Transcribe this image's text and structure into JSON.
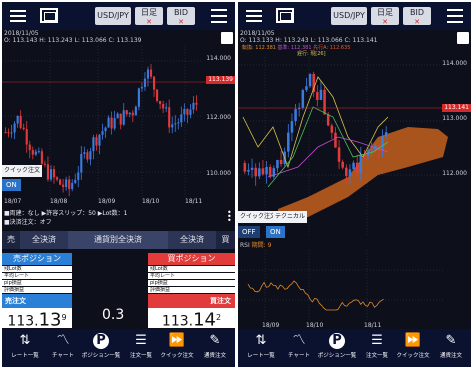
{
  "screens": [
    {
      "topbar": {
        "pair": "USD/JPY",
        "period": "日足",
        "side": "BID"
      },
      "header": {
        "date": "2018/11/05",
        "o_label": "O",
        "o": "113.143",
        "h_label": "H",
        "h": "113.243",
        "l_label": "L",
        "l": "113.066",
        "c_label": "C",
        "c": "113.139"
      },
      "axis": {
        "y": [
          "114.000",
          "112.000",
          "110.000"
        ],
        "x": [
          "18/07",
          "18/08",
          "18/09",
          "18/10",
          "18/11"
        ],
        "last_price": "113.139"
      },
      "quick_order": {
        "label": "クイック注文",
        "toggle": "ON"
      },
      "info": {
        "line1": "■両建：なし ▶許容スリップ：50 ▶Lot数：1",
        "line2": "■決済注文：オフ"
      },
      "tabs": {
        "sell": "売",
        "sell_settle": "全決済",
        "by_currency": "通貨別全決済",
        "buy_settle": "全決済",
        "buy": "買"
      },
      "sell_position": {
        "title": "売ポジション",
        "rows": [
          "残Lot数",
          "平均レート",
          "pip損益",
          "評価損益"
        ]
      },
      "buy_position": {
        "title": "買ポジション",
        "rows": [
          "残Lot数",
          "平均レート",
          "pip損益",
          "評価損益"
        ]
      },
      "sell_order": {
        "label": "売注文",
        "price_main": "113.",
        "price_big": "13",
        "price_sup": "9"
      },
      "buy_order": {
        "label": "買注文",
        "price_main": "113.",
        "price_big": "14",
        "price_sup": "2"
      },
      "spread": "0.3"
    },
    {
      "topbar": {
        "pair": "USD/JPY",
        "period": "日足",
        "side": "BID"
      },
      "header": {
        "date": "2018/11/05",
        "o_label": "O",
        "o": "113.133",
        "h_label": "H",
        "h": "113.243",
        "l_label": "L",
        "l": "113.066",
        "c_label": "C",
        "c": "113.141"
      },
      "ichimoku": {
        "tenkan": "転換: 112.381",
        "kijun": "基準: 112.381",
        "senkou": "先行A: 112.635",
        "chikou": "遅行: 現[26]"
      },
      "axis": {
        "y": [
          "114.000",
          "113.000",
          "112.000"
        ],
        "x": [
          "18/09",
          "18/10",
          "18/11"
        ],
        "last_price": "113.141"
      },
      "quick_order": {
        "label": "クイック注文",
        "technical": "テクニカル",
        "toggle_off": "OFF",
        "toggle_on": "ON"
      },
      "rsi": {
        "label": "RSI",
        "period": "期間: 9"
      }
    }
  ],
  "bottom_nav": [
    {
      "icon": "rate-list-icon",
      "label": "レート一覧"
    },
    {
      "icon": "chart-icon",
      "label": "チャート"
    },
    {
      "icon": "position-icon",
      "label": "ポジション一覧"
    },
    {
      "icon": "order-list-icon",
      "label": "注文一覧"
    },
    {
      "icon": "quick-order-icon",
      "label": "クイック注文"
    },
    {
      "icon": "notice-icon",
      "label": "通貨注文"
    }
  ],
  "colors": {
    "bull": "#3a7be0",
    "bear": "#e23b3b",
    "accent_sell": "#2a7fd6",
    "accent_buy": "#e23b3b",
    "cloud": "#c5601c"
  }
}
